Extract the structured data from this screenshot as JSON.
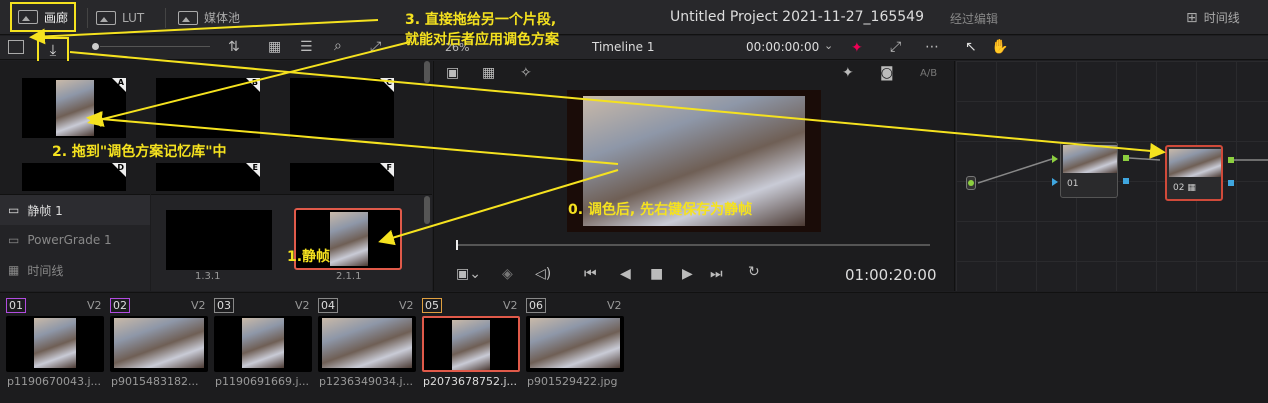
{
  "topbar": {
    "gallery_label": "画廊",
    "lut_label": "LUT",
    "media_label": "媒体池",
    "project_title": "Untitled Project 2021-11-27_165549",
    "edited_label": "经过编辑",
    "timeline_label": "时间线"
  },
  "viewer_bar": {
    "zoom": "26%",
    "timeline_name": "Timeline 1",
    "timecode": "00:00:00:00"
  },
  "gallery": {
    "stills": [
      {
        "label": "A"
      },
      {
        "label": "B"
      },
      {
        "label": "C"
      },
      {
        "label": "D"
      },
      {
        "label": "E"
      },
      {
        "label": "F"
      }
    ],
    "side": [
      "静帧 1",
      "PowerGrade 1",
      "时间线"
    ],
    "bins": [
      {
        "label": "1.3.1"
      },
      {
        "label": "2.1.1"
      }
    ]
  },
  "viewer": {
    "ab_label": "A/B",
    "timecode": "01:00:20:00"
  },
  "nodes": [
    {
      "label": "01"
    },
    {
      "label": "02"
    }
  ],
  "clips": [
    {
      "num": "01",
      "track": "V2",
      "name": "p1190670043.j...",
      "color": "#b14ce0"
    },
    {
      "num": "02",
      "track": "V2",
      "name": "p9015483182...",
      "color": "#b14ce0"
    },
    {
      "num": "03",
      "track": "V2",
      "name": "p1190691669.j...",
      "color": "#888888"
    },
    {
      "num": "04",
      "track": "V2",
      "name": "p1236349034.j...",
      "color": "#888888"
    },
    {
      "num": "05",
      "track": "V2",
      "name": "p2073678752.j...",
      "color": "#e0a040"
    },
    {
      "num": "06",
      "track": "V2",
      "name": "p901529422.jpg",
      "color": "#888888"
    }
  ],
  "annotations": {
    "a0": "0. 调色后, 先右键保存为静帧",
    "a1": "1.静帧",
    "a2": "2. 拖到\"调色方案记忆库\"中",
    "a3_line1": "3. 直接拖给另一个片段,",
    "a3_line2": "就能对后者应用调色方案"
  }
}
